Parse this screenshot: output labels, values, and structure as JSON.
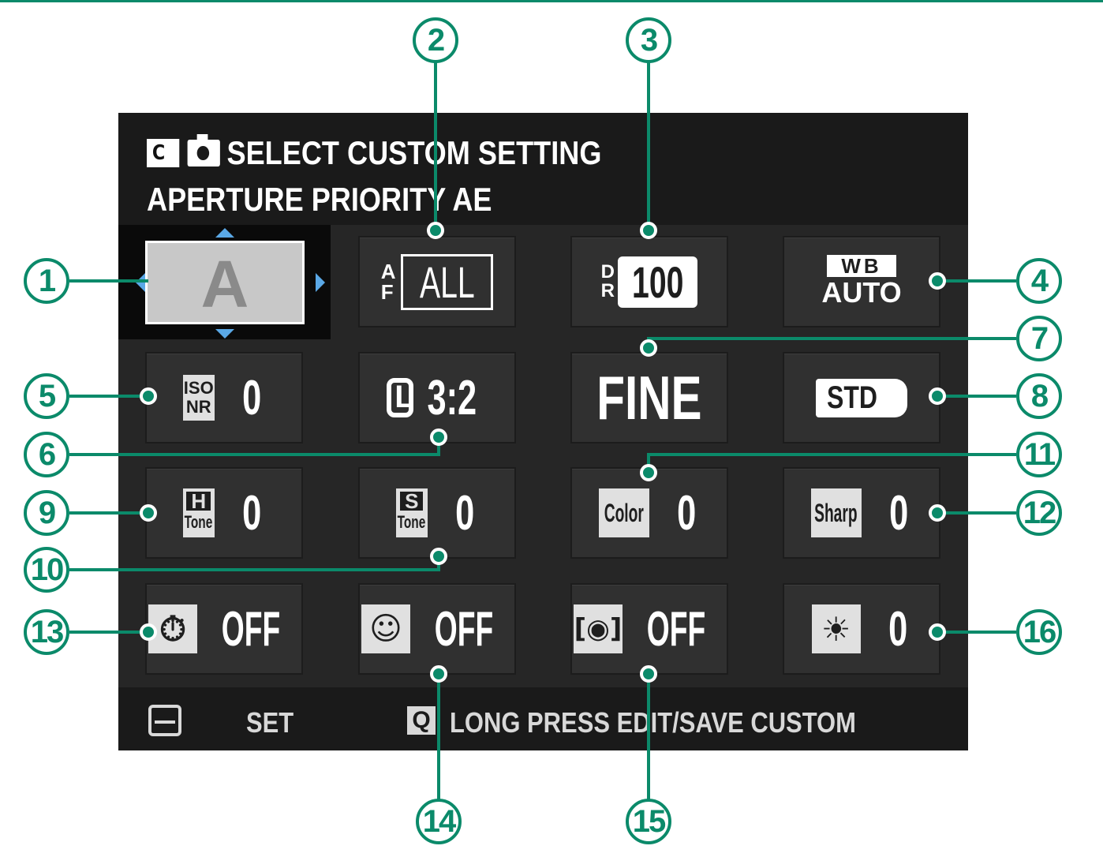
{
  "header": {
    "title_icon_c": "C",
    "title": "SELECT CUSTOM SETTING",
    "subtitle": "APERTURE PRIORITY AE"
  },
  "selected_mode": {
    "label": "A"
  },
  "tiles": {
    "af_mode": {
      "prefix_top": "A",
      "prefix_bottom": "F",
      "value": "ALL"
    },
    "dynamic_range": {
      "prefix_top": "D",
      "prefix_bottom": "R",
      "value": "100"
    },
    "white_balance": {
      "top": "WB",
      "value": "AUTO"
    },
    "iso_nr": {
      "top": "ISO",
      "bottom": "NR",
      "value": "0"
    },
    "image_size": {
      "icon": "L",
      "value": "3:2"
    },
    "image_quality": {
      "value": "FINE"
    },
    "film_simulation": {
      "value": "STD"
    },
    "highlight_tone": {
      "top": "H",
      "bottom": "Tone",
      "value": "0"
    },
    "shadow_tone": {
      "top": "S",
      "bottom": "Tone",
      "value": "0"
    },
    "color": {
      "icon": "Color",
      "value": "0"
    },
    "sharpness": {
      "icon": "Sharp",
      "value": "0"
    },
    "self_timer": {
      "value": "OFF"
    },
    "face_detection": {
      "value": "OFF"
    },
    "eye_detection": {
      "value": "OFF"
    },
    "brightness": {
      "value": "0"
    }
  },
  "footer": {
    "set_label": "SET",
    "q_key": "Q",
    "long_press_label": "LONG PRESS EDIT/SAVE CUSTOM"
  },
  "callouts": [
    "1",
    "2",
    "3",
    "4",
    "5",
    "6",
    "7",
    "8",
    "9",
    "10",
    "11",
    "12",
    "13",
    "14",
    "15",
    "16"
  ],
  "colors": {
    "accent": "#0b8a6a",
    "arrow": "#5aa8e6",
    "screen": "#262626"
  }
}
